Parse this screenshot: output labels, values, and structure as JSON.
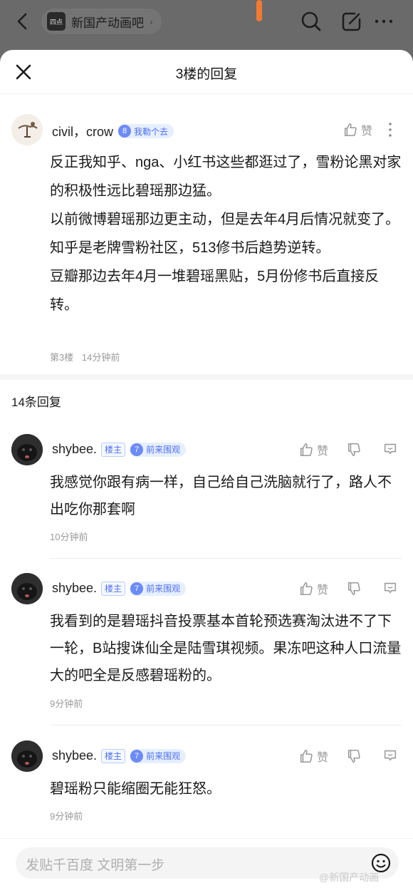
{
  "topbar": {
    "forum_name": "新国产动画吧",
    "forum_logo_text": "四点"
  },
  "sheet": {
    "title": "3楼的回复",
    "main_post": {
      "username": "civil，crow",
      "level": "8",
      "level_title": "我勒个去",
      "like_label": "赞",
      "paragraphs": [
        "反正我知乎、nga、小红书这些都逛过了，雪粉论黑对家的积极性远比碧瑶那边猛。",
        "以前微博碧瑶那边更主动，但是去年4月后情况就变了。",
        "知乎是老牌雪粉社区，513修书后趋势逆转。",
        "豆瓣那边去年4月一堆碧瑶黑贴，5月份修书后直接反转。"
      ],
      "floor": "第3楼",
      "time": "14分钟前"
    },
    "reply_count": "14条回复",
    "replies": [
      {
        "username": "shybee.",
        "host_tag": "楼主",
        "level": "7",
        "level_title": "前来围观",
        "like_label": "赞",
        "text": "我感觉你跟有病一样，自己给自己洗脑就行了，路人不出吃你那套啊",
        "time": "10分钟前"
      },
      {
        "username": "shybee.",
        "host_tag": "楼主",
        "level": "7",
        "level_title": "前来围观",
        "like_label": "赞",
        "text": "我看到的是碧瑶抖音投票基本首轮预选赛淘汰进不了下一轮，B站搜诛仙全是陆雪琪视频。果冻吧这种人口流量大的吧全是反感碧瑶粉的。",
        "time": "9分钟前"
      },
      {
        "username": "shybee.",
        "host_tag": "楼主",
        "level": "7",
        "level_title": "前来围观",
        "like_label": "赞",
        "text": "碧瑶粉只能缩圈无能狂怒。",
        "time": "9分钟前"
      }
    ],
    "input_placeholder": "发贴千百度 文明第一步",
    "watermark": "@新国产动画"
  },
  "colors": {
    "accent_blue": "#4e6ef2",
    "level_bg": "#e6efff",
    "muted": "#9a9a9a",
    "topbar": "#6a6a6a",
    "orange": "#f27a33"
  }
}
